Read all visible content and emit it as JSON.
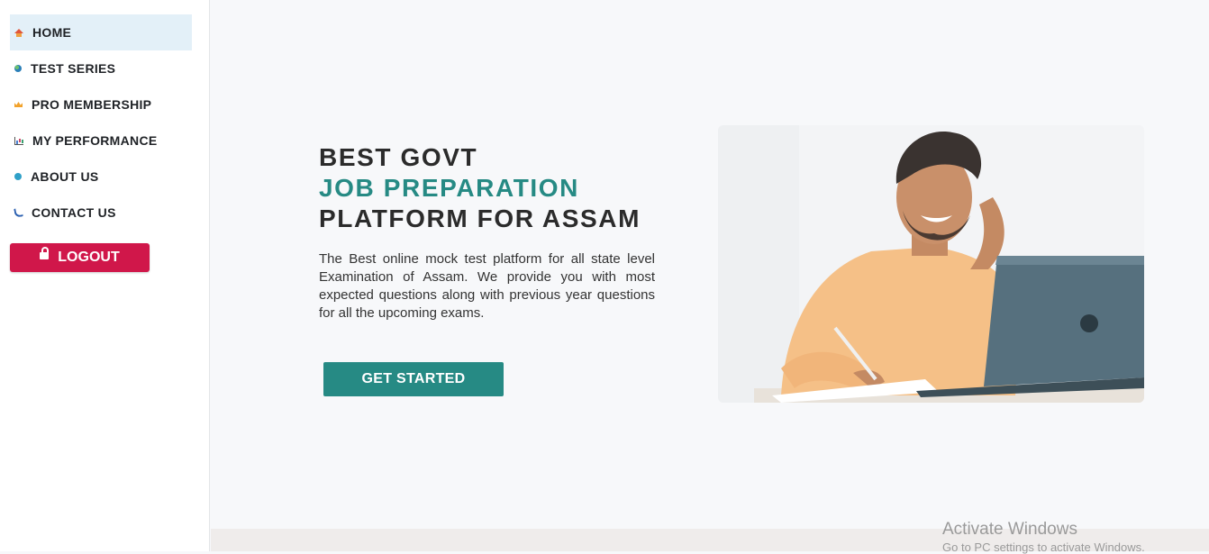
{
  "sidebar": {
    "items": [
      {
        "label": "HOME",
        "icon": "home-icon",
        "active": true
      },
      {
        "label": "TEST SERIES",
        "icon": "globe-icon",
        "active": false
      },
      {
        "label": "PRO MEMBERSHIP",
        "icon": "crown-icon",
        "active": false
      },
      {
        "label": "MY PERFORMANCE",
        "icon": "chart-icon",
        "active": false
      },
      {
        "label": "ABOUT US",
        "icon": "info-icon",
        "active": false
      },
      {
        "label": "CONTACT US",
        "icon": "phone-icon",
        "active": false
      }
    ],
    "logout_label": "LOGOUT"
  },
  "hero": {
    "title_line1": "BEST GOVT",
    "title_line2": "JOB PREPARATION",
    "title_line3": "PLATFORM FOR ASSAM",
    "description": "The Best online mock test platform for all state level Examination of Assam. We provide you with most expected questions along with previous year questions for all the upcoming exams.",
    "cta_label": "GET STARTED"
  },
  "watermark": {
    "line1": "Activate Windows",
    "line2": "Go to PC settings to activate Windows."
  },
  "colors": {
    "accent": "#268a84",
    "logout": "#d0174a",
    "active_nav_bg": "#e3f0f8"
  }
}
